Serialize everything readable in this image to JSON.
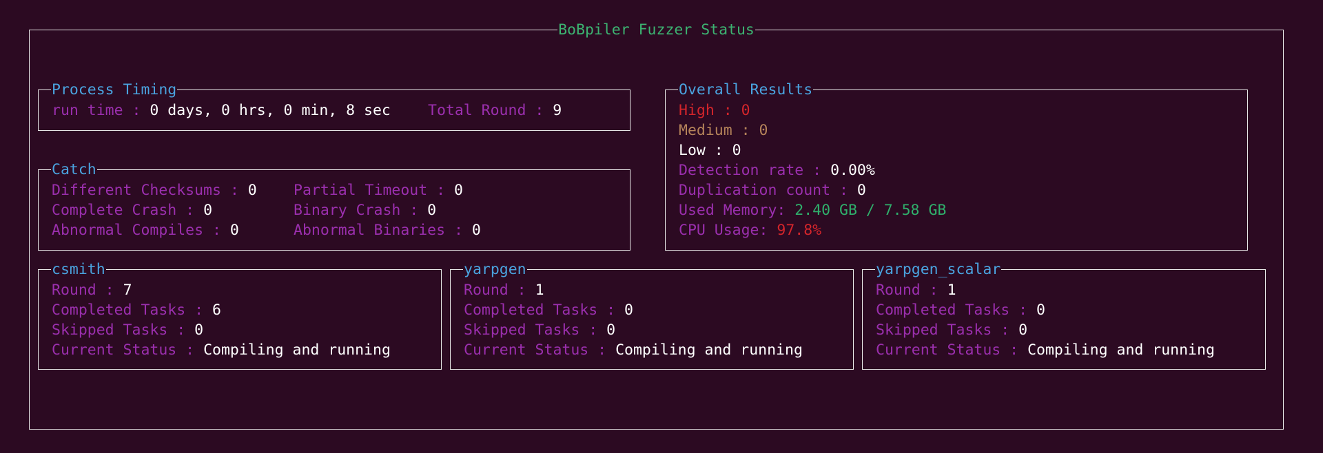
{
  "title": "BoBpiler Fuzzer Status",
  "process_timing": {
    "title": "Process Timing",
    "run_time_label": "run time : ",
    "run_time_value": "0 days, 0 hrs, 0 min, 8 sec",
    "total_round_label": "Total Round : ",
    "total_round_value": "9"
  },
  "catch": {
    "title": "Catch",
    "different_checksums_label": "Different Checksums : ",
    "different_checksums_value": "0",
    "partial_timeout_label": "Partial Timeout : ",
    "partial_timeout_value": "0",
    "complete_crash_label": "Complete Crash : ",
    "complete_crash_value": "0",
    "binary_crash_label": "Binary Crash : ",
    "binary_crash_value": "0",
    "abnormal_compiles_label": "Abnormal Compiles : ",
    "abnormal_compiles_value": "0",
    "abnormal_binaries_label": "Abnormal Binaries : ",
    "abnormal_binaries_value": "0"
  },
  "overall": {
    "title": "Overall Results",
    "high_label": "High : ",
    "high_value": "0",
    "medium_label": "Medium : ",
    "medium_value": "0",
    "low_label": "Low : ",
    "low_value": "0",
    "detection_label": "Detection rate : ",
    "detection_value": "0.00%",
    "duplication_label": "Duplication count : ",
    "duplication_value": "0",
    "memory_label": "Used Memory: ",
    "memory_value": "2.40 GB / 7.58 GB",
    "cpu_label": "CPU Usage: ",
    "cpu_value": "97.8%",
    "colors": {
      "high": "#d3252b",
      "medium": "#b5835a",
      "memory": "#2faf6b",
      "cpu": "#d3252b"
    }
  },
  "generators": [
    {
      "title": "csmith",
      "round_label": "Round : ",
      "round_value": "7",
      "completed_label": "Completed Tasks : ",
      "completed_value": "6",
      "skipped_label": "Skipped Tasks : ",
      "skipped_value": "0",
      "status_label": "Current Status : ",
      "status_value": "Compiling and running"
    },
    {
      "title": "yarpgen",
      "round_label": "Round : ",
      "round_value": "1",
      "completed_label": "Completed Tasks : ",
      "completed_value": "0",
      "skipped_label": "Skipped Tasks : ",
      "skipped_value": "0",
      "status_label": "Current Status : ",
      "status_value": "Compiling and running"
    },
    {
      "title": "yarpgen_scalar",
      "round_label": "Round : ",
      "round_value": "1",
      "completed_label": "Completed Tasks : ",
      "completed_value": "0",
      "skipped_label": "Skipped Tasks : ",
      "skipped_value": "0",
      "status_label": "Current Status : ",
      "status_value": "Compiling and running"
    }
  ]
}
